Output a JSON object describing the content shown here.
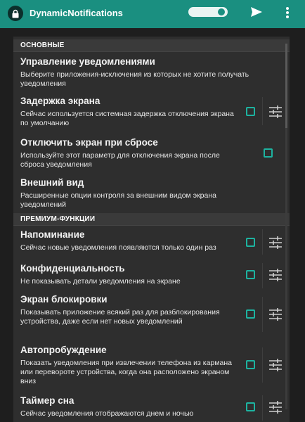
{
  "appbar": {
    "title": "DynamicNotifications",
    "icons": {
      "app": "lock-icon",
      "send": "send-icon",
      "more": "more-vert-icon"
    },
    "toggle_on": true,
    "color": "#1a8f80"
  },
  "sections": {
    "basic": "ОСНОВНЫЕ",
    "premium": "ПРЕМИУМ-ФУНКЦИИ"
  },
  "prefs": {
    "manage": {
      "title": "Управление уведомлениями",
      "summary": "Выберите приложения-исключения из которых не хотите получать уведомления"
    },
    "delay": {
      "title": "Задержка экрана",
      "summary": "Сейчас используется системная задержка отключения экрана по умолчанию",
      "checked": false
    },
    "screen_off": {
      "title": "Отключить экран при сбросе",
      "summary": "Используйте этот параметр для отключения экрана после сброса уведомления",
      "checked": false
    },
    "appearance": {
      "title": "Внешний вид",
      "summary": "Расширенные опции контроля за внешним видом экрана уведомлений"
    },
    "reminder": {
      "title": "Напоминание",
      "summary": "Сейчас новые уведомления появляются только один раз",
      "checked": false
    },
    "privacy": {
      "title": "Конфиденциальность",
      "summary": "Не показывать детали уведомления на экране",
      "checked": false
    },
    "lockscreen": {
      "title": "Экран блокировки",
      "summary": "Показывать приложение всякий раз для разблокирования устройства, даже если нет новых уведомлений",
      "checked": false
    },
    "wakeup": {
      "title": "Автопробуждение",
      "summary": "Показать уведомления при извлечении телефона из кармана или перевороте устройства, когда она расположено экраном вниз",
      "checked": false
    },
    "timer": {
      "title": "Таймер сна",
      "summary": "Сейчас уведомления отображаются днем и ночью",
      "checked": false
    }
  },
  "accent_color": "#1db3a0",
  "settings_icon": "sliders-icon"
}
